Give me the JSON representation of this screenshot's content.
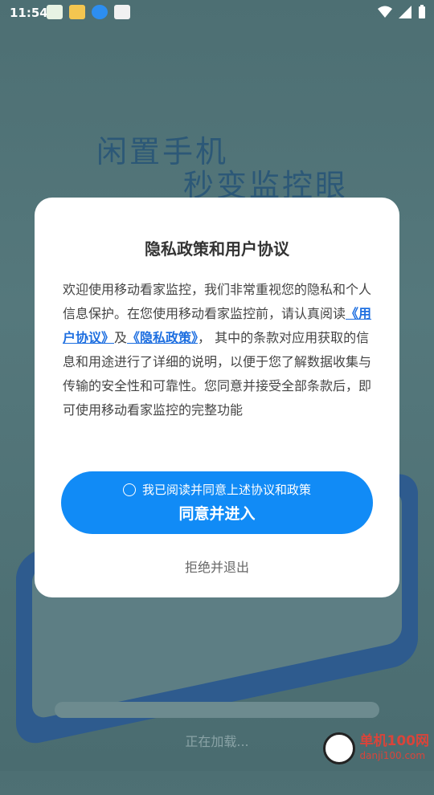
{
  "status_bar": {
    "time": "11:54"
  },
  "splash": {
    "slogan_line1": "闲置手机",
    "slogan_line2": "秒变监控眼",
    "loading_text": "正在加载..."
  },
  "dialog": {
    "title": "隐私政策和用户协议",
    "body_part1": "欢迎使用移动看家监控，我们非常重视您的隐私和个人信息保护。在您使用移动看家监控前，请认真阅读",
    "user_agreement_link": "《用户协议》",
    "and_text": "及",
    "privacy_policy_link": "《隐私政策》",
    "body_part2": "， 其中的条款对应用获取的信息和用途进行了详细的说明，以便于您了解数据收集与传输的安全性和可靠性。您同意并接受全部条款后，即可使用移动看家监控的完整功能",
    "checkbox_label": "我已阅读并同意上述协议和政策",
    "agree_button": "同意并进入",
    "reject_button": "拒绝并退出"
  },
  "watermark": {
    "line1": "单机100网",
    "line2": "danji100.com"
  },
  "colors": {
    "primary": "#118bf6",
    "link": "#1e6fe0",
    "slogan": "#2c5877"
  }
}
